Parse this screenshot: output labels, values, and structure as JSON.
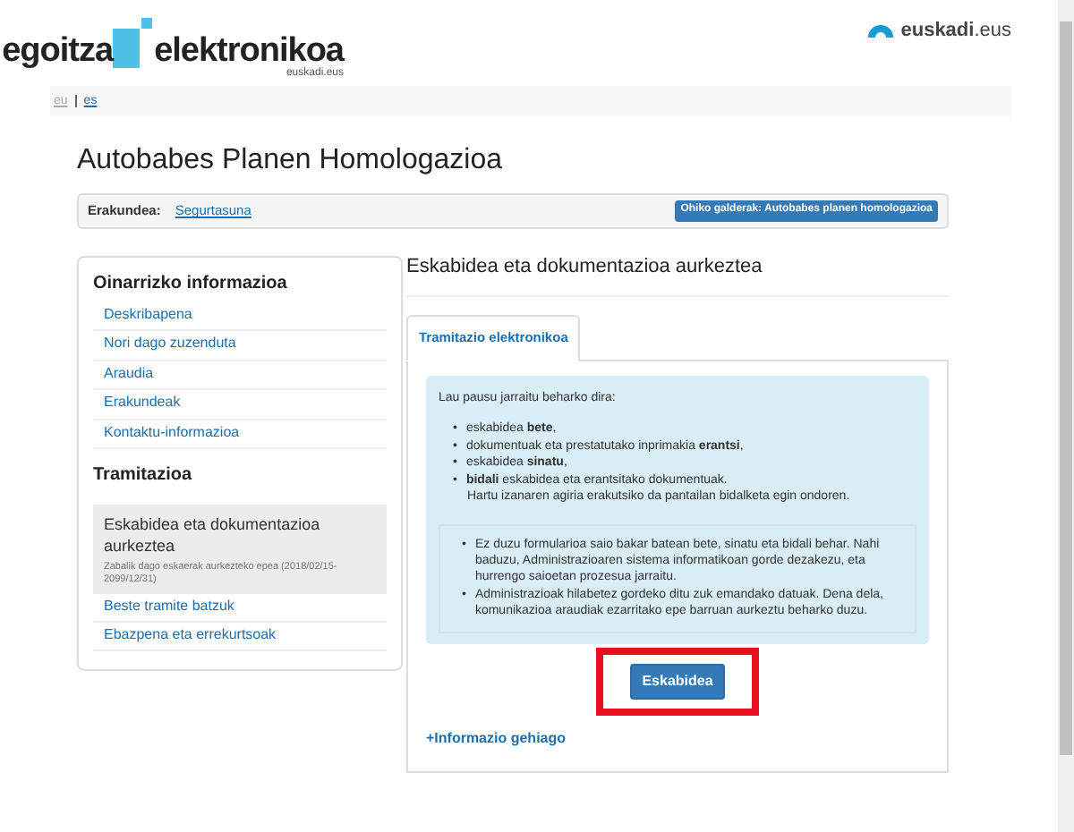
{
  "header": {
    "logo_word": "egoitza",
    "logo_word_2": "elektronikoa",
    "logo_sub": "euskadi.eus",
    "brand": "euskadi",
    "brand_suffix": ".eus"
  },
  "languages": [
    {
      "label": "eu",
      "selected": true
    },
    {
      "label": "es",
      "selected": false
    }
  ],
  "title": "Autobabes Planen Homologazioa",
  "organization": {
    "label": "Erakundea:",
    "value": "Segurtasuna",
    "faq_button": "Ohiko galderak: Autobabes planen homologazioa"
  },
  "sidebar": {
    "sections": [
      {
        "heading": "Oinarrizko informazioa",
        "items": [
          {
            "label": "Deskribapena",
            "selected": false
          },
          {
            "label": "Nori dago zuzenduta",
            "selected": false
          },
          {
            "label": "Araudia",
            "selected": false
          },
          {
            "label": "Erakundeak",
            "selected": false
          },
          {
            "label": "Kontaktu-informazioa",
            "selected": false
          }
        ]
      },
      {
        "heading": "Tramitazioa",
        "items": [
          {
            "label": "Eskabidea eta dokumentazioa aurkeztea",
            "note": "Zabalik dago eskaerak aurkezteko epea (2018/02/15-2099/12/31)",
            "selected": true
          },
          {
            "label": "Beste tramite batzuk",
            "selected": false
          },
          {
            "label": "Ebazpena eta errekurtsoak",
            "selected": false
          }
        ]
      }
    ]
  },
  "main": {
    "heading": "Eskabidea eta dokumentazioa aurkeztea",
    "tabs": [
      {
        "label": "Tramitazio elektronikoa",
        "selected": true
      }
    ],
    "intro": "Lau pausu jarraitu beharko dira:",
    "bullet": "•",
    "steps": [
      "eskabidea **bete**,",
      "dokumentuak eta prestatutako inprimakia **erantsi**,",
      "eskabidea **sinatu**,",
      "**bidali** eskabidea eta erantsitako dokumentuak."
    ],
    "steps_note": "Hartu izanaren agiria erakutsiko da pantailan bidalketa egin ondoren.",
    "notes": [
      "Ez duzu formularioa saio bakar batean bete, sinatu eta bidali behar. Nahi baduzu, Administrazioaren sistema informatikoan gorde dezakezu, eta hurrengo saioetan prozesua jarraitu.",
      "Administrazioak hilabetez gordeko ditu zuk emandako datuak. Dena dela, komunikazioa araudiak ezarritako epe barruan aurkeztu beharko duzu."
    ],
    "apply_button": {
      "label": "Eskabidea",
      "highlighted": true
    },
    "more_link": "+Informazio gehiago"
  }
}
